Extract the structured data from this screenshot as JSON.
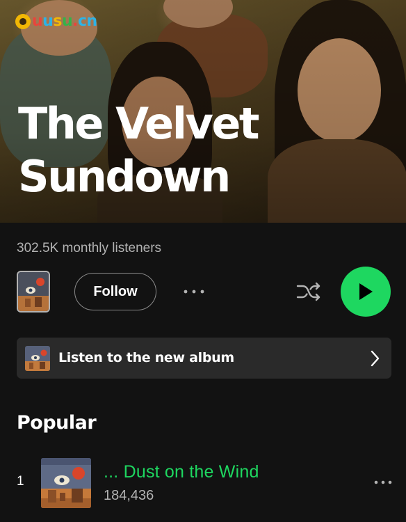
{
  "watermark": {
    "text_parts": [
      "u",
      "u",
      "s",
      "u",
      ".",
      "cn"
    ]
  },
  "artist": {
    "name_line1": "The Velvet",
    "name_line2": "Sundown",
    "monthly_listeners": "302.5K monthly listeners"
  },
  "controls": {
    "follow_label": "Follow",
    "more_icon": "more-horizontal-icon",
    "shuffle_icon": "shuffle-icon",
    "play_icon": "play-icon"
  },
  "banner": {
    "label": "Listen to the new album",
    "chevron_icon": "chevron-right-icon"
  },
  "popular": {
    "title": "Popular",
    "tracks": [
      {
        "rank": "1",
        "title": "... Dust on the Wind",
        "plays": "184,436"
      }
    ]
  },
  "colors": {
    "accent": "#1ed760",
    "background": "#121212",
    "banner_bg": "#2a2a2a",
    "secondary_text": "#b3b3b3"
  }
}
